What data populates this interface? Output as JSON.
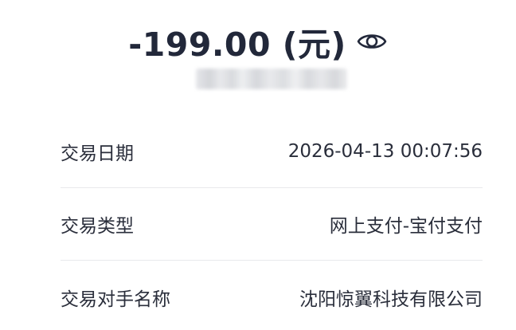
{
  "header": {
    "amount_text": "-199.00 (元)",
    "visibility_icon": "eye-icon"
  },
  "details": [
    {
      "label": "交易日期",
      "value": "2026-04-13 00:07:56"
    },
    {
      "label": "交易类型",
      "value": "网上支付-宝付支付"
    },
    {
      "label": "交易对手名称",
      "value": "沈阳惊翼科技有限公司"
    }
  ],
  "colors": {
    "amount": "#22283a",
    "text": "#2a2e3b",
    "divider": "#e8e9ec",
    "background": "#ffffff"
  }
}
